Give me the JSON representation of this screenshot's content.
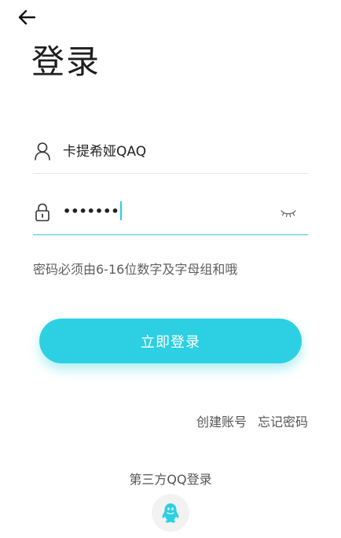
{
  "header": {
    "back_icon": "arrow-left-icon",
    "title": "登录"
  },
  "form": {
    "username": {
      "icon": "user-icon",
      "value": "卡提希娅QAQ"
    },
    "password": {
      "icon": "lock-icon",
      "value": "•••••••",
      "toggle_icon": "eye-closed-icon"
    },
    "hint": "密码必须由6-16位数字及字母组和哦",
    "submit_label": "立即登录"
  },
  "links": {
    "register": "创建账号",
    "forgot": "忘记密码"
  },
  "third_party": {
    "label": "第三方QQ登录",
    "qq_icon": "qq-penguin-icon"
  },
  "colors": {
    "accent": "#2dd0e2",
    "text": "#222222",
    "muted": "#555555"
  }
}
